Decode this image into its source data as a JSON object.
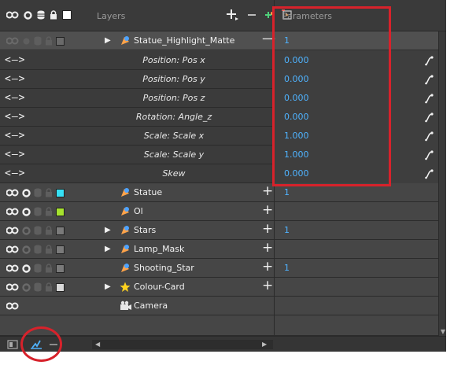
{
  "header": {
    "layers_label": "Layers",
    "parameters_label": "Parameters"
  },
  "top_layer": {
    "name": "Statue_Highlight_Matte",
    "value": "1"
  },
  "functions": [
    {
      "arrows": "<—>",
      "label": "Position: Pos x",
      "value": "0.000"
    },
    {
      "arrows": "<—>",
      "label": "Position: Pos y",
      "value": "0.000"
    },
    {
      "arrows": "<—>",
      "label": "Position: Pos z",
      "value": "0.000"
    },
    {
      "arrows": "<—>",
      "label": "Rotation: Angle_z",
      "value": "0.000"
    },
    {
      "arrows": "<—>",
      "label": "Scale: Scale x",
      "value": "1.000"
    },
    {
      "arrows": "<—>",
      "label": "Scale: Scale y",
      "value": "1.000"
    },
    {
      "arrows": "<—>",
      "label": "Skew",
      "value": "0.000"
    }
  ],
  "layers": [
    {
      "name": "Statue",
      "value": "1",
      "color": "#36e0f5"
    },
    {
      "name": "Ol",
      "value": "",
      "color": "#a6e22e"
    },
    {
      "name": "Stars",
      "value": "1",
      "color": "#7a7a7a"
    },
    {
      "name": "Lamp_Mask",
      "value": "",
      "color": "#7a7a7a"
    },
    {
      "name": "Shooting_Star",
      "value": "1",
      "color": "#7a7a7a"
    },
    {
      "name": "Colour-Card",
      "value": "",
      "color": "#d9d9d9"
    },
    {
      "name": "Camera",
      "value": "",
      "color": ""
    }
  ],
  "colors": {
    "accent_value": "#4fb3ff",
    "annotation_red": "#d7222b",
    "panel_bg": "#414141"
  }
}
